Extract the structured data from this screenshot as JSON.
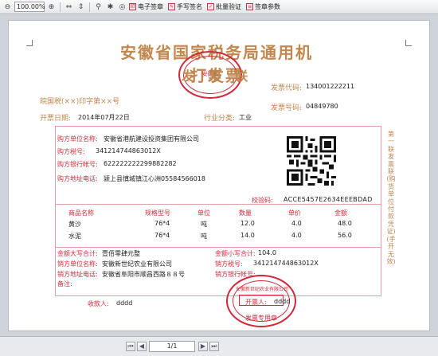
{
  "toolbar": {
    "zoom_value": "100.00%",
    "buttons": [
      {
        "icon": "zoom-out-icon",
        "glyph": "⊖"
      },
      {
        "icon": "zoom-in-icon",
        "glyph": "⊕"
      },
      {
        "icon": "fit-width-icon",
        "glyph": "⇔"
      },
      {
        "icon": "fit-page-icon",
        "glyph": "⇕"
      },
      {
        "icon": "search-icon",
        "glyph": "⚲"
      },
      {
        "icon": "pin-icon",
        "glyph": "✱"
      },
      {
        "icon": "eye-icon",
        "glyph": "◎"
      }
    ],
    "actions": [
      {
        "label": "电子签章"
      },
      {
        "label": "手写签名"
      },
      {
        "label": "批量验证"
      },
      {
        "label": "签章参数"
      }
    ]
  },
  "invoice": {
    "title": "安徽省国家税务局通用机打发票",
    "subtitle": "发 票 联",
    "seal_top_text": "安徽省",
    "code_label": "发票代码:",
    "code_value": "134001222211",
    "number_label": "发票号码:",
    "number_value": "04849780",
    "form_note": "皖国税(××)印字第××号",
    "date_label": "开票日期:",
    "date_value": "2014年07月22日",
    "industry_label": "行业分类:",
    "industry_value": "工业",
    "buyer_name_label": "购方单位名称:",
    "buyer_name_value": "安徽省港航建设投资集团有限公司",
    "buyer_tax_label": "购方税号:",
    "buyer_tax_value": "341214744863012X",
    "buyer_bank_label": "购方银行帐号:",
    "buyer_bank_value": "622222222299882282",
    "buyer_addr_label": "购方地址电话:",
    "buyer_addr_value": "颍上县慎城镇江心洲05584566018",
    "check_label": "校验码:",
    "check_value": "ACCE5457E2634EEEBDAD",
    "items_header": [
      "商品名称",
      "规格型号",
      "单位",
      "数量",
      "单价",
      "金额"
    ],
    "items": [
      [
        "黄沙",
        "76*4",
        "吨",
        "12.0",
        "4.0",
        "48.0"
      ],
      [
        "水泥",
        "76*4",
        "吨",
        "14.0",
        "4.0",
        "56.0"
      ]
    ],
    "total_upper_label": "金额大写合计:",
    "total_upper_value": "壹佰零肆元整",
    "total_lower_label": "金额小写合计:",
    "total_lower_value": "104.0",
    "seller_name_label": "销方单位名称:",
    "seller_name_value": "安徽新世纪农业有限公司",
    "seller_tax_label": "销方税号:",
    "seller_tax_value": "341214744863012X",
    "seller_addr_label": "销方地址电话:",
    "seller_addr_value": "安徽省阜阳市顺昌西路８８号",
    "seller_bank_label": "销方银行帐号:",
    "remark_label": "备注:",
    "payee_label": "收款人:",
    "payee_value": "dddd",
    "drawer_label": "开票人:",
    "drawer_value": "dddd",
    "side_text": "第一联发票联(购货单位付款凭证)(手开无效)",
    "seal_bottom_arc": "安徽新世纪农业有限公司",
    "seal_bottom_text": "发票专用章"
  },
  "statusbar": {
    "page_value": "1/1"
  },
  "colors": {
    "accent_red": "#d02a3c",
    "brown": "#c2874f",
    "box_line": "#e2a1a6"
  }
}
